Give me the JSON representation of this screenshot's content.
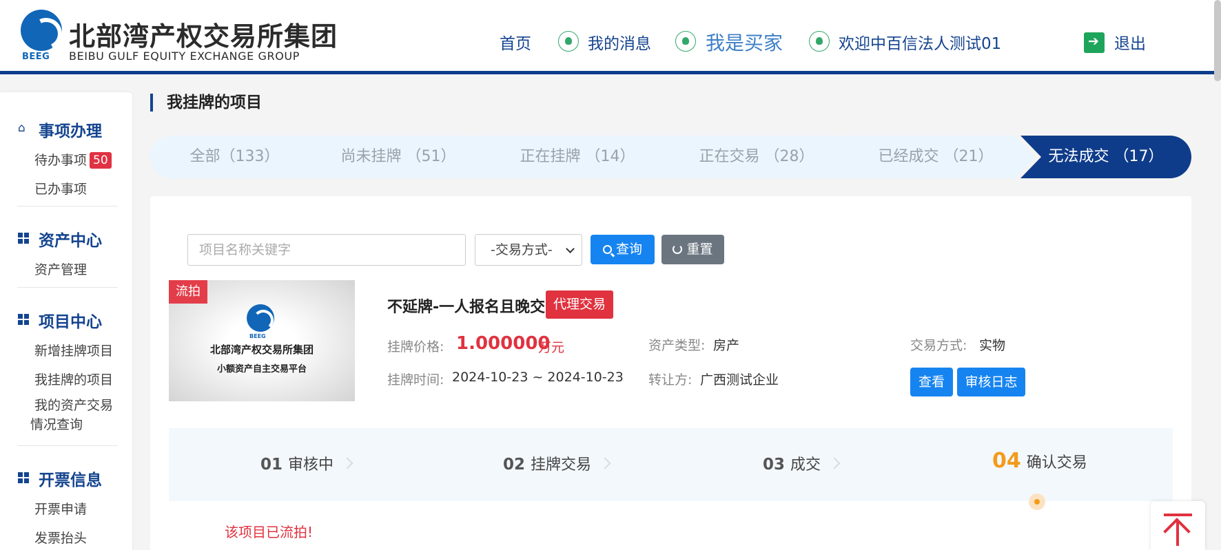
{
  "header": {
    "logo_cn": "北部湾产权交易所集团",
    "logo_en": "BEIBU GULF EQUITY EXCHANGE GROUP",
    "logo_abbr": "BEEG",
    "nav": {
      "home": "首页",
      "messages": "我的消息",
      "buyer": "我是买家",
      "welcome": "欢迎中百信法人测试01",
      "logout": "退出"
    }
  },
  "sidebar": {
    "sections": [
      {
        "title": "事项办理",
        "icon": "home-icon",
        "items": [
          {
            "label": "待办事项",
            "badge": "50"
          },
          {
            "label": "已办事项"
          }
        ]
      },
      {
        "title": "资产中心",
        "icon": "grid-icon",
        "items": [
          {
            "label": "资产管理"
          }
        ]
      },
      {
        "title": "项目中心",
        "icon": "grid-icon",
        "items": [
          {
            "label": "新增挂牌项目"
          },
          {
            "label": "我挂牌的项目"
          },
          {
            "label": "我的资产交易情况查询"
          }
        ]
      },
      {
        "title": "开票信息",
        "icon": "grid-icon",
        "items": [
          {
            "label": "开票申请"
          },
          {
            "label": "发票抬头"
          }
        ]
      }
    ]
  },
  "main": {
    "title": "我挂牌的项目",
    "tabs": [
      {
        "label": "全部（133）"
      },
      {
        "label": "尚未挂牌 （51）"
      },
      {
        "label": "正在挂牌 （14）"
      },
      {
        "label": "正在交易 （28）"
      },
      {
        "label": "已经成交 （21）"
      },
      {
        "label": "无法成交 （17）",
        "active": true
      }
    ],
    "search": {
      "placeholder": "项目名称关键字",
      "trade_select": "-交易方式-",
      "query_label": "查询",
      "reset_label": "重置"
    },
    "project": {
      "flag": "流拍",
      "thumb_title": "北部湾产权交易所集团",
      "thumb_subtitle": "小额资产自主交易平台",
      "thumb_abbr": "BEEG",
      "title": "不延牌-一人报名且晚交",
      "tag": "代理交易",
      "price_label": "挂牌价格:",
      "price": "1.000000",
      "price_unit": "万元",
      "time_label": "挂牌时间:",
      "time": "2024-10-23 ~ 2024-10-23",
      "asset_type_label": "资产类型:",
      "asset_type": "房产",
      "transferor_label": "转让方:",
      "transferor": "广西测试企业",
      "trade_mode_label": "交易方式:",
      "trade_mode": "实物",
      "view_label": "查看",
      "log_label": "审核日志"
    },
    "steps": [
      {
        "num": "01",
        "label": "审核中"
      },
      {
        "num": "02",
        "label": "挂牌交易"
      },
      {
        "num": "03",
        "label": "成交"
      },
      {
        "num": "04",
        "label": "确认交易",
        "active": true
      }
    ],
    "note": "该项目已流拍!"
  },
  "colors": {
    "primary": "#0f3c8a",
    "accent": "#1684f0",
    "danger": "#e0323f",
    "step_active": "#f29b1a",
    "icon_green": "#31a86a"
  }
}
